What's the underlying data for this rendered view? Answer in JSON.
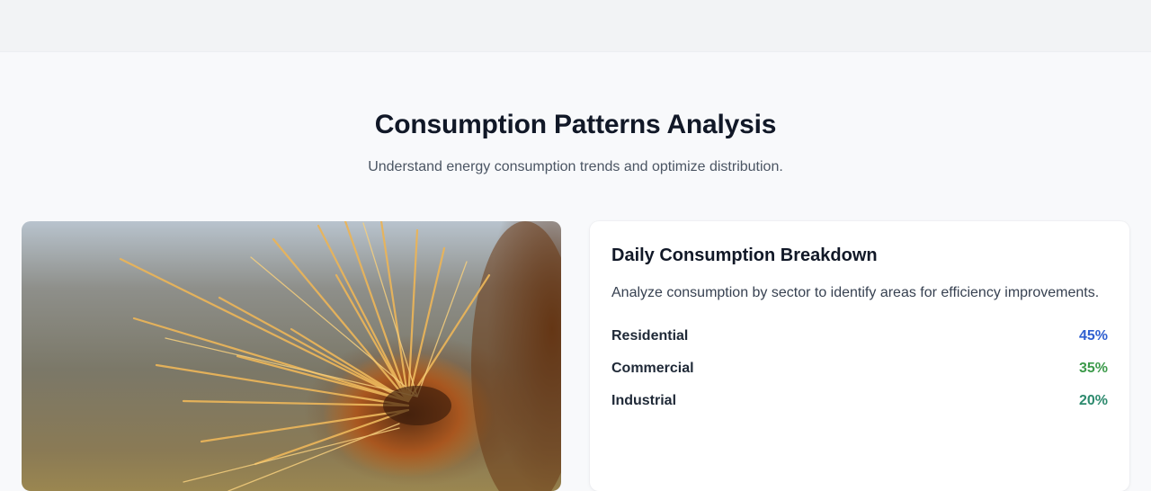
{
  "section": {
    "title": "Consumption Patterns Analysis",
    "subtitle": "Understand energy consumption trends and optimize distribution."
  },
  "image": {
    "subject": "close-up photo of spiky orange plant"
  },
  "card": {
    "title": "Daily Consumption Breakdown",
    "description": "Analyze consumption by sector to identify areas for efficiency improvements.",
    "sectors": [
      {
        "label": "Residential",
        "value": "45%",
        "color": "#2f5fd0"
      },
      {
        "label": "Commercial",
        "value": "35%",
        "color": "#3c9a4a"
      },
      {
        "label": "Industrial",
        "value": "20%",
        "color": "#2d8a6e"
      }
    ]
  }
}
